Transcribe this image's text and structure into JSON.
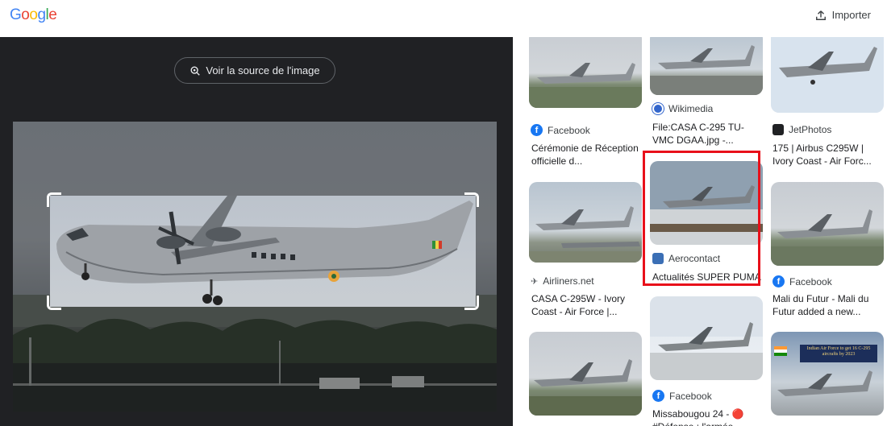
{
  "header": {
    "logo_text": "Google",
    "import_label": "Importer"
  },
  "viewer": {
    "source_button_label": "Voir la source de l'image"
  },
  "results": [
    {
      "source": "",
      "title": "",
      "icon": "none"
    },
    {
      "source": "Wikimedia",
      "title": "File:CASA C-295 TU-VMC DGAA.jpg -...",
      "icon": "wikimedia-icon"
    },
    {
      "source": "",
      "title": "",
      "icon": "none"
    },
    {
      "source": "Facebook",
      "title": "Cérémonie de Réception officielle d...",
      "icon": "facebook-icon"
    },
    {
      "source": "JetPhotos",
      "title": "175 | Airbus C295W | Ivory Coast - Air Forc...",
      "icon": "jetphotos-icon"
    },
    {
      "source": "Aerocontact",
      "title": "Actualités SUPER PUMA",
      "icon": "aerocontact-icon"
    },
    {
      "source": "Airliners.net",
      "title": "CASA C-295W - Ivory Coast - Air Force |...",
      "icon": "airliners-icon"
    },
    {
      "source": "Facebook",
      "title": "Mali du Futur - Mali du Futur added a new...",
      "icon": "facebook-icon"
    },
    {
      "source": "Facebook",
      "title": "Missabougou 24 - 🔴 #Défense : l'armée...",
      "icon": "facebook-icon"
    },
    {
      "source": "",
      "title": "Indian Air Force to get 16 C-295 aircrafts by 2023",
      "icon": "none"
    }
  ],
  "colors": {
    "viewer_bg": "#202124",
    "highlight": "#e8101a",
    "facebook": "#1877f2"
  }
}
